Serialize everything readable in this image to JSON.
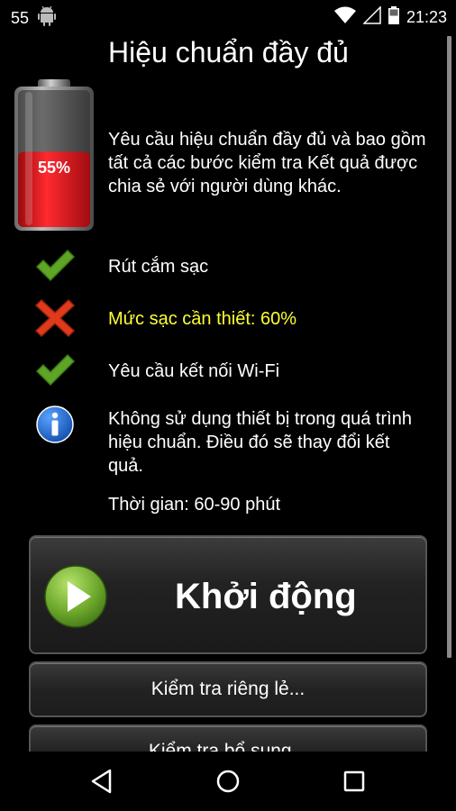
{
  "status_bar": {
    "notification_count": "55",
    "time": "21:23",
    "icons": [
      "android-icon",
      "wifi-icon",
      "signal-icon",
      "battery-icon"
    ]
  },
  "header": {
    "title": "Hiệu chuẩn đầy đủ"
  },
  "battery": {
    "level_percent": 55,
    "label": "55%",
    "fill_color": "#e8141b"
  },
  "description": {
    "lines": [
      "Yêu cầu hiệu chuẩn đầy đủ và bao gồm",
      "tất cả các bước kiểm tra Kết quả được",
      "chia sẻ với người dùng khác."
    ]
  },
  "requirements": [
    {
      "icon": "check-icon",
      "status": "ok",
      "text": "Rút cắm sạc"
    },
    {
      "icon": "cross-icon",
      "status": "error",
      "text": "Mức sạc cần thiết: 60%"
    },
    {
      "icon": "check-icon",
      "status": "ok",
      "text": "Yêu cầu kết nối Wi-Fi"
    },
    {
      "icon": "info-icon",
      "status": "info",
      "lines": [
        "Không sử dụng thiết bị trong quá trình",
        "hiệu chuẩn. Điều đó sẽ thay đổi kết",
        "quả."
      ]
    }
  ],
  "duration": "Thời gian: 60-90 phút",
  "buttons": {
    "start_label": "Khởi động",
    "individual_label": "Kiểm tra riêng lẻ...",
    "additional_label": "Kiểm tra bổ sung..."
  },
  "colors": {
    "warning_text": "#ffff33",
    "check_green": "#5ea526",
    "cross_red": "#e03a1c",
    "info_blue": "#1a63c9"
  },
  "nav_bar": {
    "icons": [
      "back-icon",
      "home-icon",
      "recents-icon"
    ]
  }
}
